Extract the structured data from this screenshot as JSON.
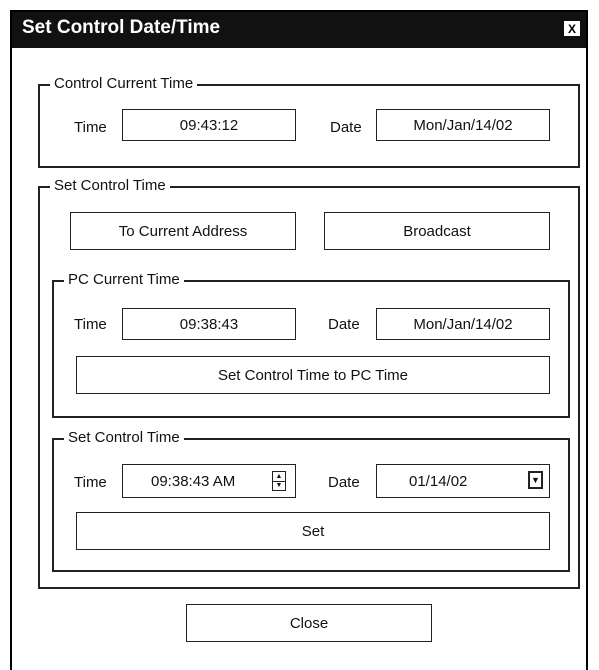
{
  "window": {
    "title": "Set Control Date/Time",
    "close_glyph": "X"
  },
  "control_current_time": {
    "legend": "Control Current Time",
    "time_label": "Time",
    "time_value": "09:43:12",
    "date_label": "Date",
    "date_value": "Mon/Jan/14/02"
  },
  "set_control_time": {
    "legend": "Set Control Time",
    "to_current_address_label": "To Current Address",
    "broadcast_label": "Broadcast",
    "pc_current_time": {
      "legend": "PC Current Time",
      "time_label": "Time",
      "time_value": "09:38:43",
      "date_label": "Date",
      "date_value": "Mon/Jan/14/02",
      "set_to_pc_label": "Set Control Time to PC Time"
    },
    "manual": {
      "legend": "Set Control Time",
      "time_label": "Time",
      "time_value": "09:38:43 AM",
      "date_label": "Date",
      "date_value": "01/14/02",
      "set_label": "Set",
      "icons": {
        "spinner_up": "up-arrow-icon",
        "spinner_down": "down-arrow-icon",
        "dropdown": "dropdown-arrow-icon"
      }
    }
  },
  "footer": {
    "close_label": "Close"
  }
}
